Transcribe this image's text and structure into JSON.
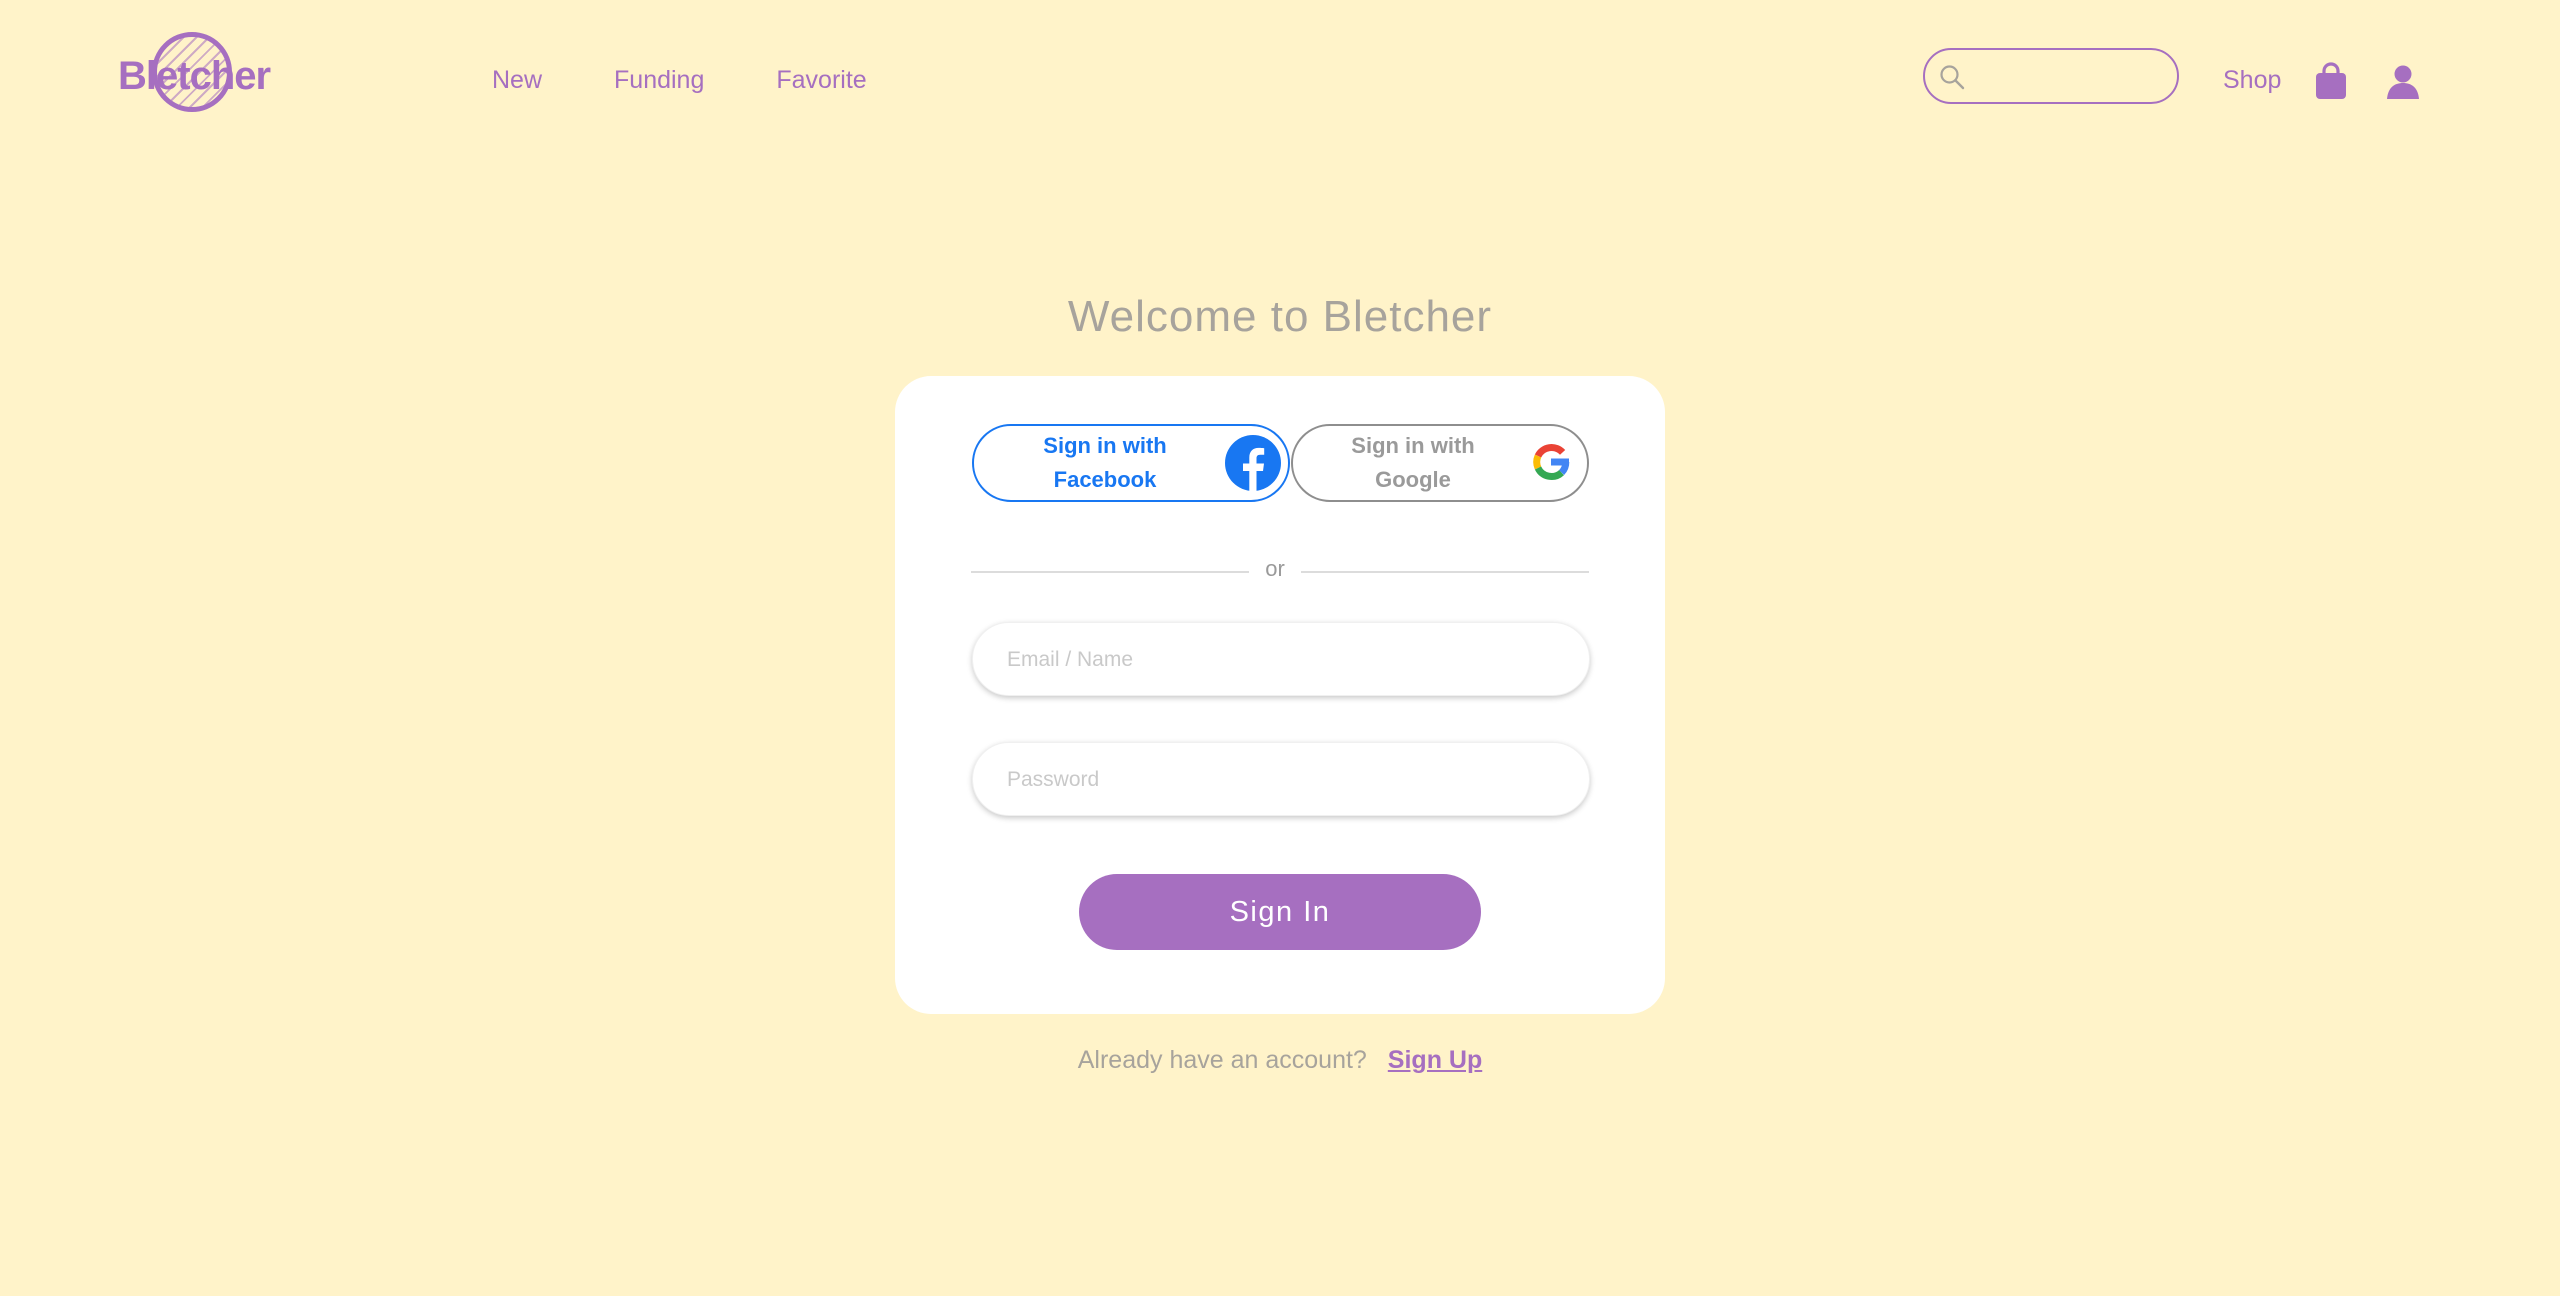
{
  "header": {
    "logo_text": "Bletcher",
    "nav": [
      "New",
      "Funding",
      "Favorite"
    ],
    "search": {
      "placeholder": "",
      "value": ""
    },
    "shop_label": "Shop",
    "icons": [
      "search-icon",
      "shopping-bag-icon",
      "user-icon"
    ]
  },
  "main": {
    "title": "Welcome to Bletcher",
    "facebook_label": "Sign in with Facebook",
    "google_label": "Sign in with Google",
    "divider_text": "or",
    "email_placeholder": "Email / Name",
    "password_placeholder": "Password",
    "signin_label": "Sign In"
  },
  "footer": {
    "question": "Already have an account?",
    "signup_label": "Sign Up"
  },
  "colors": {
    "background": "#fff3c9",
    "accent": "#a66fc0",
    "facebook": "#1877f2",
    "muted_text": "#a7a39c"
  }
}
